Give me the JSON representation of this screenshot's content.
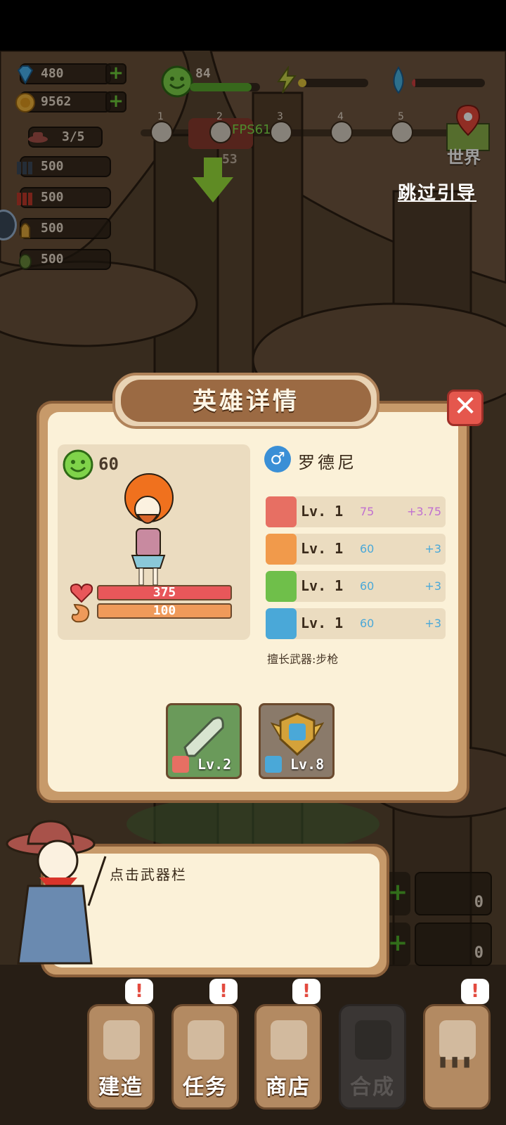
{
  "resources": {
    "diamonds": "480",
    "gold": "9562",
    "population": "3/5",
    "ammo": [
      "500",
      "500",
      "500",
      "500"
    ]
  },
  "status": {
    "mood_value": "84",
    "mood_fill": 0.88,
    "energy_fill": 0.12,
    "water_fill": 0.05
  },
  "stages": {
    "labels": [
      "1",
      "2",
      "3",
      "4",
      "5"
    ],
    "fps": "FPS61",
    "timer_partial": "53",
    "world_label": "世界"
  },
  "skip_guide": "跳过引导",
  "dialog": {
    "title": "英雄详情",
    "close": "✕",
    "hero": {
      "mood": "60",
      "gender_symbol": "♂",
      "name": "罗德尼",
      "hp": "375",
      "hp_fill": 1.0,
      "hunger": "100",
      "hunger_fill": 1.0
    },
    "skills": [
      {
        "icon": "sword-icon",
        "level": "Lv. 1",
        "value": "75",
        "plus": "+3.75",
        "color": "#e76f63",
        "val_color": "#c070d0"
      },
      {
        "icon": "muscle-icon",
        "level": "Lv. 1",
        "value": "60",
        "plus": "+3",
        "color": "#f19a4b",
        "val_color": "#4aa8d8"
      },
      {
        "icon": "lightbulb-icon",
        "level": "Lv. 1",
        "value": "60",
        "plus": "+3",
        "color": "#6fbf4a",
        "val_color": "#4aa8d8"
      },
      {
        "icon": "brain-icon",
        "level": "Lv. 1",
        "value": "60",
        "plus": "+3",
        "color": "#4aa8d8",
        "val_color": "#4aa8d8"
      }
    ],
    "weapon_hint": "擅长武器:步枪",
    "equipment": [
      {
        "name": "bullet",
        "level": "Lv.2"
      },
      {
        "name": "badge",
        "level": "Lv.8"
      }
    ]
  },
  "guide": {
    "text": "点击武器栏"
  },
  "side_counters": [
    "0",
    "0"
  ],
  "nav": [
    {
      "label": "建造",
      "alert": "!"
    },
    {
      "label": "任务",
      "alert": "!"
    },
    {
      "label": "商店",
      "alert": "!"
    },
    {
      "label": "合成",
      "alert": ""
    },
    {
      "label": "",
      "alert": "!"
    }
  ],
  "colors": {
    "hp": "#e8575a",
    "hunger": "#ef9a5a",
    "mood_green": "#7fd34a"
  }
}
